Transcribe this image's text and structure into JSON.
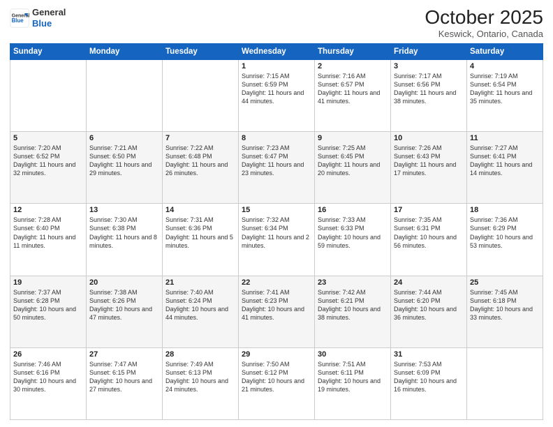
{
  "header": {
    "logo_general": "General",
    "logo_blue": "Blue",
    "month_title": "October 2025",
    "location": "Keswick, Ontario, Canada"
  },
  "days_of_week": [
    "Sunday",
    "Monday",
    "Tuesday",
    "Wednesday",
    "Thursday",
    "Friday",
    "Saturday"
  ],
  "weeks": [
    [
      {
        "day": "",
        "info": ""
      },
      {
        "day": "",
        "info": ""
      },
      {
        "day": "",
        "info": ""
      },
      {
        "day": "1",
        "info": "Sunrise: 7:15 AM\nSunset: 6:59 PM\nDaylight: 11 hours and 44 minutes."
      },
      {
        "day": "2",
        "info": "Sunrise: 7:16 AM\nSunset: 6:57 PM\nDaylight: 11 hours and 41 minutes."
      },
      {
        "day": "3",
        "info": "Sunrise: 7:17 AM\nSunset: 6:56 PM\nDaylight: 11 hours and 38 minutes."
      },
      {
        "day": "4",
        "info": "Sunrise: 7:19 AM\nSunset: 6:54 PM\nDaylight: 11 hours and 35 minutes."
      }
    ],
    [
      {
        "day": "5",
        "info": "Sunrise: 7:20 AM\nSunset: 6:52 PM\nDaylight: 11 hours and 32 minutes."
      },
      {
        "day": "6",
        "info": "Sunrise: 7:21 AM\nSunset: 6:50 PM\nDaylight: 11 hours and 29 minutes."
      },
      {
        "day": "7",
        "info": "Sunrise: 7:22 AM\nSunset: 6:48 PM\nDaylight: 11 hours and 26 minutes."
      },
      {
        "day": "8",
        "info": "Sunrise: 7:23 AM\nSunset: 6:47 PM\nDaylight: 11 hours and 23 minutes."
      },
      {
        "day": "9",
        "info": "Sunrise: 7:25 AM\nSunset: 6:45 PM\nDaylight: 11 hours and 20 minutes."
      },
      {
        "day": "10",
        "info": "Sunrise: 7:26 AM\nSunset: 6:43 PM\nDaylight: 11 hours and 17 minutes."
      },
      {
        "day": "11",
        "info": "Sunrise: 7:27 AM\nSunset: 6:41 PM\nDaylight: 11 hours and 14 minutes."
      }
    ],
    [
      {
        "day": "12",
        "info": "Sunrise: 7:28 AM\nSunset: 6:40 PM\nDaylight: 11 hours and 11 minutes."
      },
      {
        "day": "13",
        "info": "Sunrise: 7:30 AM\nSunset: 6:38 PM\nDaylight: 11 hours and 8 minutes."
      },
      {
        "day": "14",
        "info": "Sunrise: 7:31 AM\nSunset: 6:36 PM\nDaylight: 11 hours and 5 minutes."
      },
      {
        "day": "15",
        "info": "Sunrise: 7:32 AM\nSunset: 6:34 PM\nDaylight: 11 hours and 2 minutes."
      },
      {
        "day": "16",
        "info": "Sunrise: 7:33 AM\nSunset: 6:33 PM\nDaylight: 10 hours and 59 minutes."
      },
      {
        "day": "17",
        "info": "Sunrise: 7:35 AM\nSunset: 6:31 PM\nDaylight: 10 hours and 56 minutes."
      },
      {
        "day": "18",
        "info": "Sunrise: 7:36 AM\nSunset: 6:29 PM\nDaylight: 10 hours and 53 minutes."
      }
    ],
    [
      {
        "day": "19",
        "info": "Sunrise: 7:37 AM\nSunset: 6:28 PM\nDaylight: 10 hours and 50 minutes."
      },
      {
        "day": "20",
        "info": "Sunrise: 7:38 AM\nSunset: 6:26 PM\nDaylight: 10 hours and 47 minutes."
      },
      {
        "day": "21",
        "info": "Sunrise: 7:40 AM\nSunset: 6:24 PM\nDaylight: 10 hours and 44 minutes."
      },
      {
        "day": "22",
        "info": "Sunrise: 7:41 AM\nSunset: 6:23 PM\nDaylight: 10 hours and 41 minutes."
      },
      {
        "day": "23",
        "info": "Sunrise: 7:42 AM\nSunset: 6:21 PM\nDaylight: 10 hours and 38 minutes."
      },
      {
        "day": "24",
        "info": "Sunrise: 7:44 AM\nSunset: 6:20 PM\nDaylight: 10 hours and 36 minutes."
      },
      {
        "day": "25",
        "info": "Sunrise: 7:45 AM\nSunset: 6:18 PM\nDaylight: 10 hours and 33 minutes."
      }
    ],
    [
      {
        "day": "26",
        "info": "Sunrise: 7:46 AM\nSunset: 6:16 PM\nDaylight: 10 hours and 30 minutes."
      },
      {
        "day": "27",
        "info": "Sunrise: 7:47 AM\nSunset: 6:15 PM\nDaylight: 10 hours and 27 minutes."
      },
      {
        "day": "28",
        "info": "Sunrise: 7:49 AM\nSunset: 6:13 PM\nDaylight: 10 hours and 24 minutes."
      },
      {
        "day": "29",
        "info": "Sunrise: 7:50 AM\nSunset: 6:12 PM\nDaylight: 10 hours and 21 minutes."
      },
      {
        "day": "30",
        "info": "Sunrise: 7:51 AM\nSunset: 6:11 PM\nDaylight: 10 hours and 19 minutes."
      },
      {
        "day": "31",
        "info": "Sunrise: 7:53 AM\nSunset: 6:09 PM\nDaylight: 10 hours and 16 minutes."
      },
      {
        "day": "",
        "info": ""
      }
    ]
  ]
}
